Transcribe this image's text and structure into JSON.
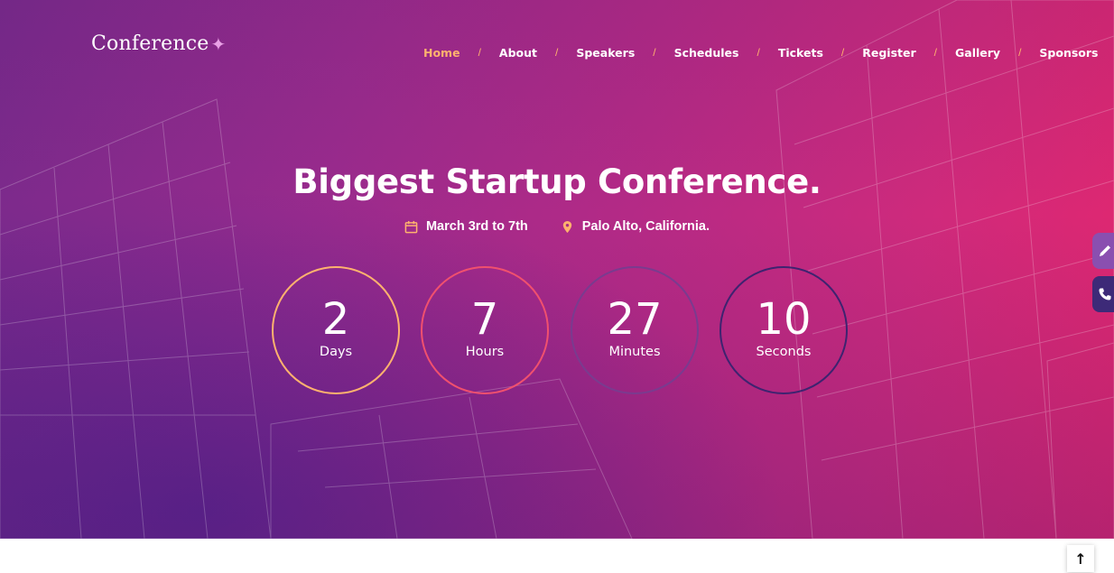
{
  "brand": {
    "name": "Conference",
    "star": "✦"
  },
  "nav": {
    "items": [
      {
        "label": "Home",
        "active": true
      },
      {
        "label": "About"
      },
      {
        "label": "Speakers"
      },
      {
        "label": "Schedules"
      },
      {
        "label": "Tickets"
      },
      {
        "label": "Register"
      },
      {
        "label": "Gallery"
      },
      {
        "label": "Sponsors"
      }
    ],
    "separator": "/"
  },
  "hero": {
    "title": "Biggest Startup Conference.",
    "date": "March 3rd to 7th",
    "location": "Palo Alto, California.",
    "date_icon": "calendar-icon",
    "location_icon": "map-pin-icon"
  },
  "countdown": [
    {
      "value": "2",
      "label": "Days",
      "ring_color": "#ffb26e"
    },
    {
      "value": "7",
      "label": "Hours",
      "ring_color": "#f0506e"
    },
    {
      "value": "27",
      "label": "Minutes",
      "ring_color": "#7a3b8f"
    },
    {
      "value": "10",
      "label": "Seconds",
      "ring_color": "#3e2370"
    }
  ],
  "side_buttons": [
    {
      "icon": "pencil-icon",
      "color": "#8a4fb0"
    },
    {
      "icon": "phone-icon",
      "color": "#3d2a78"
    }
  ],
  "scroll_top": {
    "icon": "arrow-up-icon",
    "glyph": "↑"
  },
  "colors": {
    "accent": "#ffb26e",
    "gradient_start": "#7a2a8c",
    "gradient_end": "#e2276f"
  }
}
